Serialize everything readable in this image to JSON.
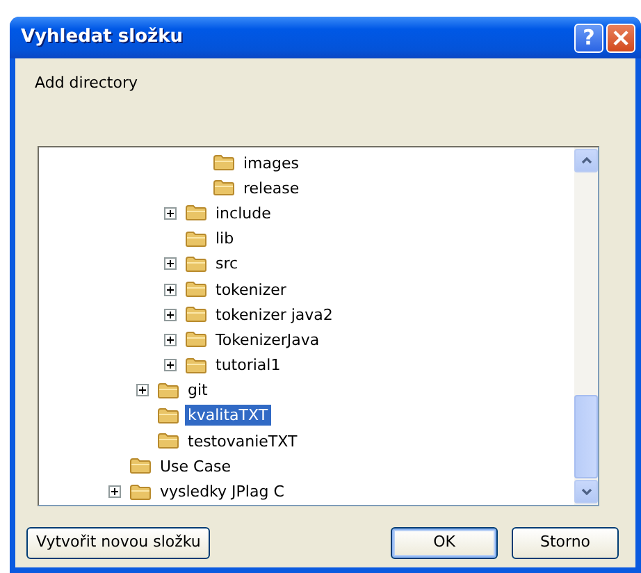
{
  "window": {
    "title": "Vyhledat složku",
    "help_button": "?",
    "close_button": "×"
  },
  "description": "Add directory",
  "tree": [
    {
      "children": [
        {
          "children": [
            {
              "children": [
                {
                  "label": "images",
                  "expandable": false,
                  "selected": false
                },
                {
                  "label": "release",
                  "expandable": false,
                  "selected": false
                }
              ]
            },
            {
              "label": "include",
              "expandable": true,
              "selected": false
            },
            {
              "label": "lib",
              "expandable": false,
              "selected": false
            },
            {
              "label": "src",
              "expandable": true,
              "selected": false
            },
            {
              "label": "tokenizer",
              "expandable": true,
              "selected": false
            },
            {
              "label": "tokenizer java2",
              "expandable": true,
              "selected": false
            },
            {
              "label": "TokenizerJava",
              "expandable": true,
              "selected": false
            },
            {
              "label": "tutorial1",
              "expandable": true,
              "selected": false
            }
          ]
        },
        {
          "label": "git",
          "expandable": true,
          "selected": false
        },
        {
          "label": "kvalitaTXT",
          "expandable": false,
          "selected": true
        },
        {
          "label": "testovanieTXT",
          "expandable": false,
          "selected": false
        }
      ]
    },
    {
      "label": "Use Case",
      "expandable": false,
      "selected": false
    },
    {
      "label": "vysledky JPlag C",
      "expandable": true,
      "selected": false
    }
  ],
  "buttons": [
    {
      "kind": "new_folder",
      "label": "Vytvořit novou složku"
    },
    {
      "kind": "ok",
      "label": "OK",
      "default": true
    },
    {
      "kind": "cancel",
      "label": "Storno",
      "default": false
    }
  ]
}
